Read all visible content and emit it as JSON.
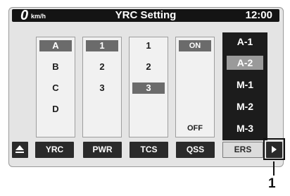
{
  "header": {
    "speed_value": "0",
    "speed_unit": "km/h",
    "title": "YRC Setting",
    "clock": "12:00"
  },
  "columns": {
    "yrc_modes": {
      "items": [
        "A",
        "B",
        "C",
        "D"
      ],
      "selected_index": 0
    },
    "pwr_levels": {
      "items": [
        "1",
        "2",
        "3"
      ],
      "selected_index": 0
    },
    "tcs_levels": {
      "items": [
        "1",
        "2",
        "3"
      ],
      "selected_index": 2
    },
    "qss": {
      "on_label": "ON",
      "off_label": "OFF",
      "selected": "ON"
    },
    "ers_presets": {
      "items": [
        "A-1",
        "A-2",
        "M-1",
        "M-2",
        "M-3"
      ],
      "selected_index": 1
    }
  },
  "tabs": {
    "yrc": "YRC",
    "pwr": "PWR",
    "tcs": "TCS",
    "qss": "QSS",
    "ers": "ERS"
  },
  "callout": {
    "number": "1"
  },
  "icons": {
    "eject": "eject-icon",
    "next": "play-next-icon"
  },
  "colors": {
    "screen_bg": "#e4e4e4",
    "header_bg": "#141414",
    "selection": "#6b6b6b",
    "preset_bg": "#1c1c1c"
  }
}
